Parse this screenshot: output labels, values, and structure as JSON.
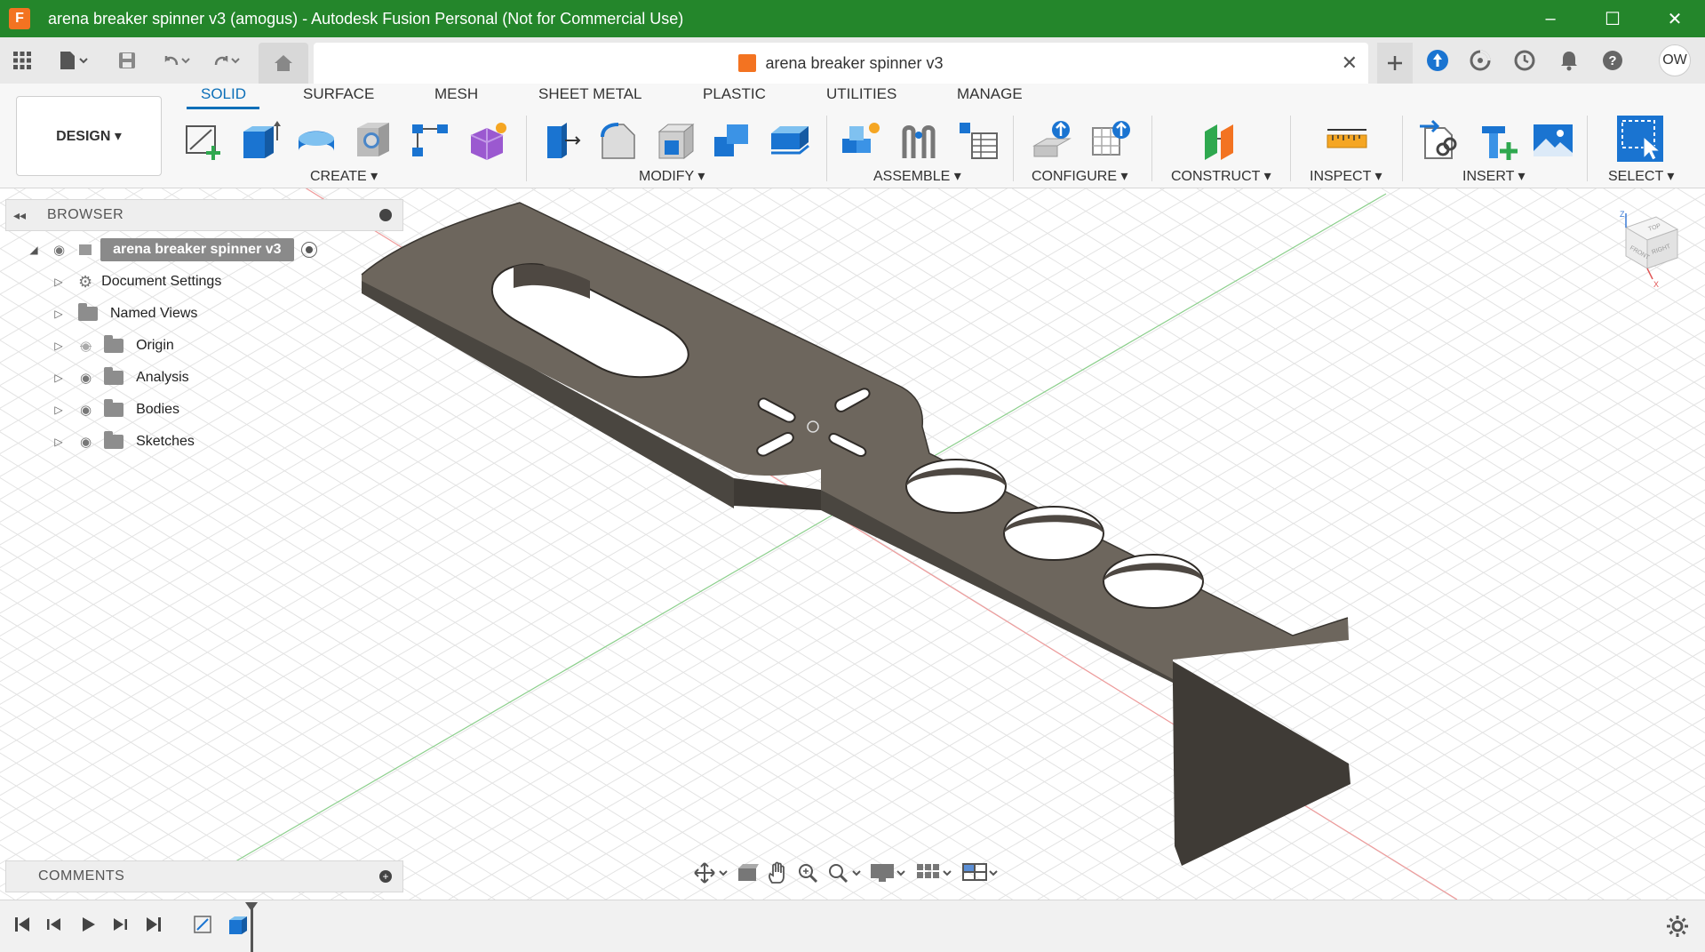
{
  "window": {
    "title": "arena breaker spinner v3 (amogus) - Autodesk Fusion Personal (Not for Commercial Use)",
    "app_logo": "F",
    "controls": [
      "–",
      "☐",
      "✕"
    ],
    "accent_color": "#24862b"
  },
  "tabbar": {
    "document_title": "arena breaker spinner v3",
    "close_glyph": "✕",
    "avatar_initials": "OW"
  },
  "ribbon": {
    "workspace_label": "DESIGN ▾",
    "tabs": [
      {
        "label": "SOLID",
        "active": true
      },
      {
        "label": "SURFACE"
      },
      {
        "label": "MESH"
      },
      {
        "label": "SHEET METAL"
      },
      {
        "label": "PLASTIC"
      },
      {
        "label": "UTILITIES"
      },
      {
        "label": "MANAGE"
      }
    ],
    "groups": [
      {
        "label": "CREATE ▾"
      },
      {
        "label": "MODIFY ▾"
      },
      {
        "label": "ASSEMBLE ▾"
      },
      {
        "label": "CONFIGURE ▾"
      },
      {
        "label": "CONSTRUCT ▾"
      },
      {
        "label": "INSPECT ▾"
      },
      {
        "label": "INSERT ▾"
      },
      {
        "label": "SELECT ▾"
      }
    ]
  },
  "browser": {
    "title": "BROWSER",
    "root": "arena breaker spinner v3",
    "items": [
      {
        "label": "Document Settings",
        "icon": "gear-icon"
      },
      {
        "label": "Named Views",
        "icon": "folder-icon"
      },
      {
        "label": "Origin",
        "icon": "folder-icon",
        "hidden": true
      },
      {
        "label": "Analysis",
        "icon": "folder-icon"
      },
      {
        "label": "Bodies",
        "icon": "folder-icon"
      },
      {
        "label": "Sketches",
        "icon": "folder-icon"
      }
    ]
  },
  "viewcube": {
    "faces": [
      "TOP",
      "FRONT",
      "RIGHT"
    ],
    "axes": [
      "Z",
      "X"
    ]
  },
  "comments": {
    "title": "COMMENTS"
  }
}
